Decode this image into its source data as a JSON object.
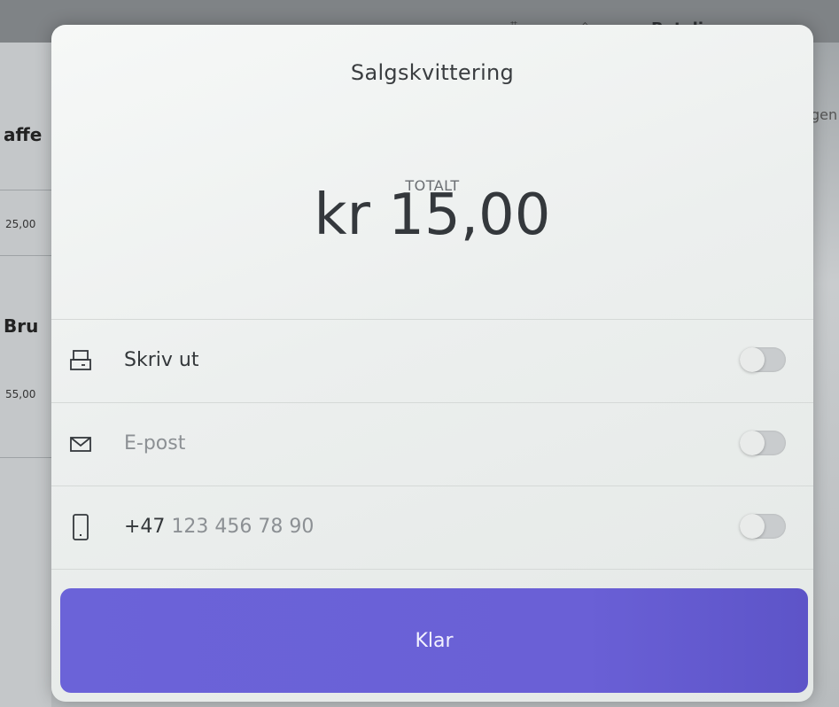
{
  "background": {
    "top_label": "Betaling",
    "left_items": [
      {
        "title": "affe",
        "price": "25,00"
      },
      {
        "title": "Bru",
        "price": "55,00"
      }
    ],
    "right_fragment": "gen"
  },
  "modal": {
    "title": "Salgskvittering",
    "total_label": "TOTALT",
    "total_amount": "kr 15,00",
    "options": [
      {
        "icon": "printer-icon",
        "label": "Skriv ut",
        "placeholder": false,
        "enabled": false
      },
      {
        "icon": "mail-icon",
        "label": "E-post",
        "placeholder": true,
        "enabled": false
      },
      {
        "icon": "phone-icon",
        "prefix": "+47",
        "label": "123 456 78 90",
        "placeholder": true,
        "enabled": false
      }
    ],
    "done_label": "Klar"
  },
  "colors": {
    "accent": "#6b63d8",
    "modal_bg": "#eef1f0",
    "toggle_off": "#c9ccce"
  }
}
